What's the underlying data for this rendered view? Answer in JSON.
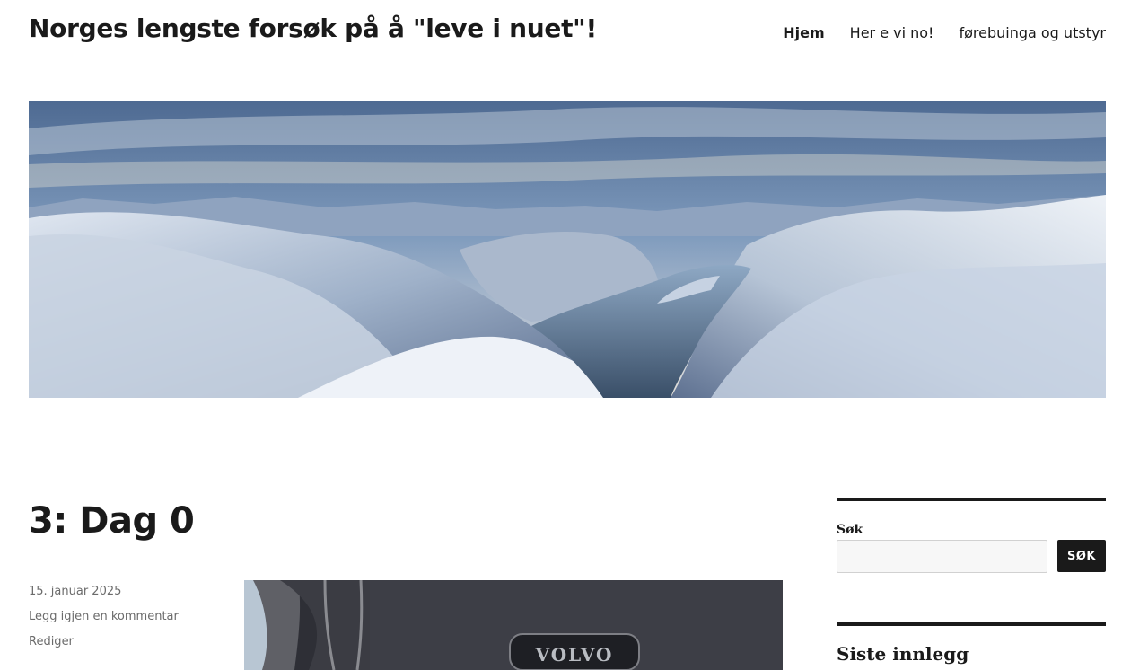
{
  "site": {
    "title": "Norges lengste forsøk på å \"leve i nuet\"!"
  },
  "nav": {
    "items": [
      {
        "label": "Hjem",
        "current": true
      },
      {
        "label": "Her e vi no!",
        "current": false
      },
      {
        "label": "førebuinga og utstyr",
        "current": false
      }
    ]
  },
  "post": {
    "title": "3: Dag 0",
    "date": "15. januar 2025",
    "comment_link": "Legg igjen en kommentar",
    "edit_link": "Rediger",
    "image_text": "VOLVO"
  },
  "sidebar": {
    "search": {
      "label": "Søk",
      "value": "",
      "placeholder": "",
      "button_label": "SØK"
    },
    "recent_posts_title": "Siste innlegg"
  },
  "colors": {
    "text": "#1a1a1a",
    "meta": "#6b6b6b",
    "input_bg": "#f7f7f7",
    "input_border": "#d1d1d1",
    "button_bg": "#1a1a1a",
    "button_text": "#ffffff"
  }
}
